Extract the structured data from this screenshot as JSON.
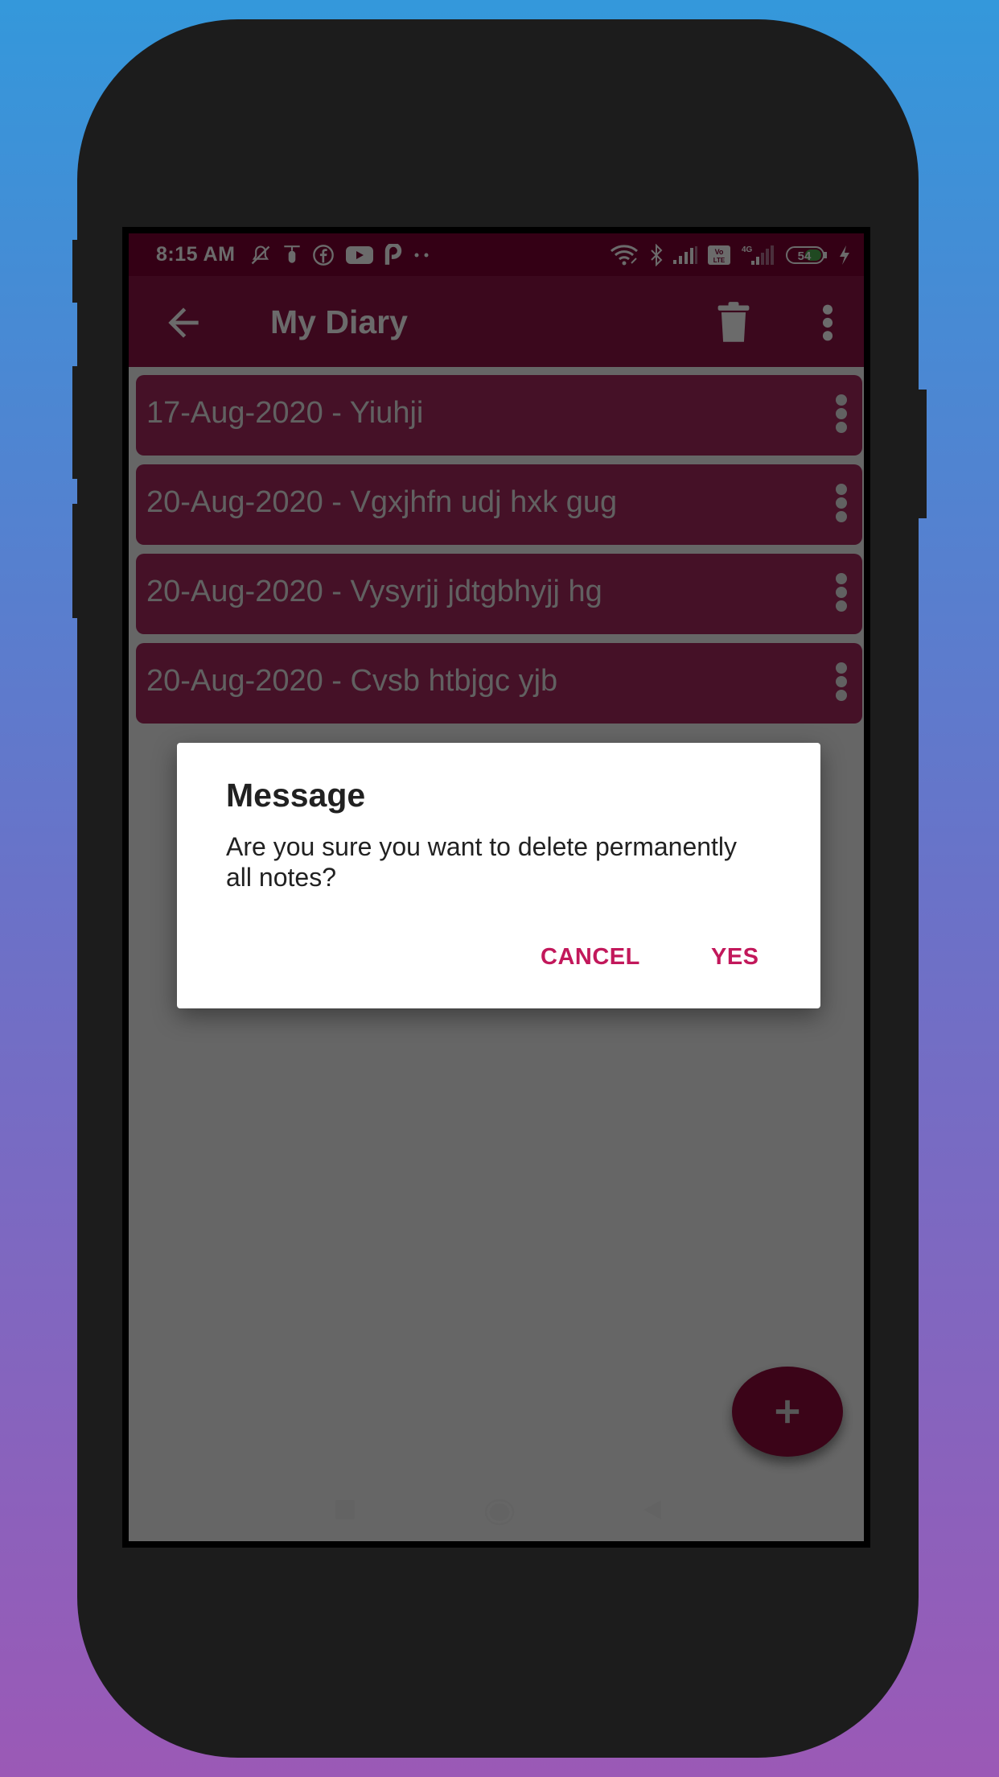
{
  "status_bar": {
    "time": "8:15 AM",
    "battery_level": "54",
    "network_label": "4G",
    "volte_label": "Vo LTE",
    "left_icons": [
      "muted-bell-icon",
      "scooter-icon",
      "facebook-icon",
      "youtube-icon",
      "p-app-icon",
      "more-dots-icon"
    ],
    "right_icons": [
      "wifi-icon",
      "bluetooth-icon",
      "signal-icon",
      "volte-icon",
      "signal-4g-icon",
      "battery-icon",
      "charging-icon"
    ]
  },
  "app_bar": {
    "title": "My Diary",
    "back_icon": "arrow-back-icon",
    "delete_icon": "trash-icon",
    "overflow_icon": "more-vert-icon"
  },
  "notes": [
    {
      "label": "17-Aug-2020 - Yiuhji"
    },
    {
      "label": "20-Aug-2020 - Vgxjhfn udj hxk gug"
    },
    {
      "label": "20-Aug-2020 - Vysyrjj jdtgbhyjj hg"
    },
    {
      "label": "20-Aug-2020 - Cvsb htbjgc yjb"
    }
  ],
  "fab": {
    "icon": "plus-icon",
    "label": "+"
  },
  "dialog": {
    "title": "Message",
    "message": "Are you sure you want to delete permanently all notes?",
    "cancel_label": "CANCEL",
    "confirm_label": "YES"
  },
  "nav_bar": {
    "icons": [
      "recents-square-icon",
      "home-circle-icon",
      "back-triangle-icon"
    ]
  },
  "colors": {
    "status_bar": "#7d0033",
    "app_bar": "#8e1446",
    "note_card": "#a5295d",
    "fab": "#8e0a3a",
    "dialog_button": "#c2185b",
    "background_top": "#3498db",
    "background_bottom": "#9b59b6"
  }
}
